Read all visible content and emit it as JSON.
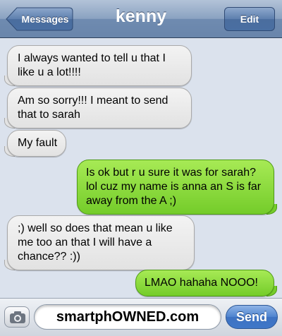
{
  "header": {
    "back_label": "Messages",
    "title": "kenny",
    "edit_label": "Edit"
  },
  "messages": [
    {
      "side": "received",
      "text": "I always wanted to tell u that I like u a lot!!!!"
    },
    {
      "side": "received",
      "text": "Am so sorry!!! I meant to send that to sarah"
    },
    {
      "side": "received",
      "text": "My fault"
    },
    {
      "side": "sent",
      "text": "Is ok but r u sure it was for sarah? lol cuz my name is anna an S is far away from the A ;)"
    },
    {
      "side": "received",
      "text": ";) well so does that mean u like me too an that I will have a chance?? :))"
    },
    {
      "side": "sent",
      "text": "LMAO hahaha NOOO!"
    }
  ],
  "composer": {
    "field_text": "smartphOWNED.com",
    "send_label": "Send",
    "camera_icon": "camera-icon"
  },
  "colors": {
    "received_bubble": "#e4e4e4",
    "sent_bubble": "#8bdc3d",
    "thread_background": "#dbe2ed",
    "navbar": "#7f98bb",
    "send_button": "#4a7fcd"
  }
}
